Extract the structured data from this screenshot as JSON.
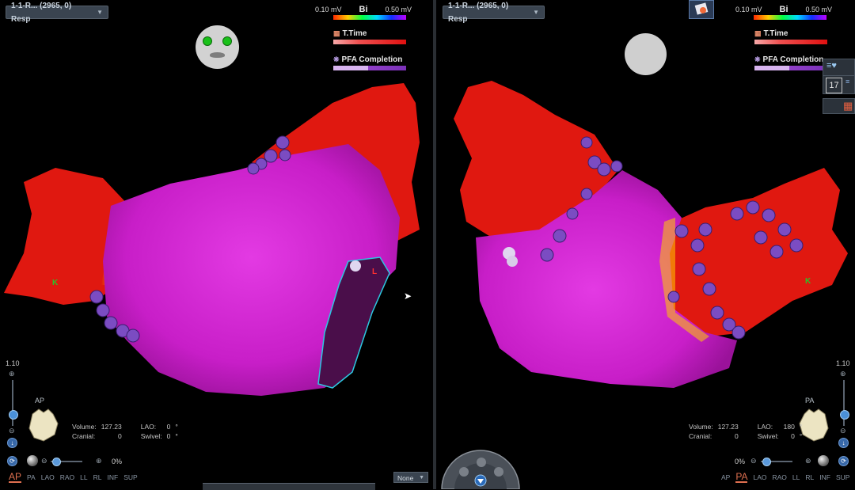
{
  "left_view": {
    "map_selector": "1-1-R... (2965, 0) Resp",
    "scale": {
      "min": "0.10 mV",
      "label": "Bi",
      "max": "0.50 mV"
    },
    "legend": {
      "ttime_label": "T.Time",
      "pfa_label": "PFA Completion",
      "pfa_completion": 0.48
    },
    "zoom": "1.10",
    "orientation_label": "AP",
    "info": {
      "volume_label": "Volume:",
      "volume_value": "127.23",
      "lao_label": "LAO:",
      "lao_value": "0",
      "cranial_label": "Cranial:",
      "cranial_value": "0",
      "swivel_label": "Swivel:",
      "swivel_value": "0",
      "deg": "°"
    },
    "slider_percent": "0%",
    "views": [
      "AP",
      "PA",
      "LAO",
      "RAO",
      "LL",
      "RL",
      "INF",
      "SUP"
    ],
    "active_view": "AP",
    "display_select": "None",
    "markers": {
      "k": "K",
      "l": "L"
    }
  },
  "right_view": {
    "map_selector": "1-1-R... (2965, 0) Resp",
    "scale": {
      "min": "0.10 mV",
      "label": "Bi",
      "max": "0.50 mV"
    },
    "legend": {
      "ttime_label": "T.Time",
      "pfa_label": "PFA Completion",
      "pfa_completion": 0.48
    },
    "zoom": "1.10",
    "orientation_label": "PA",
    "info": {
      "volume_label": "Volume:",
      "volume_value": "127.23",
      "lao_label": "LAO:",
      "lao_value": "180",
      "cranial_label": "Cranial:",
      "cranial_value": "0",
      "swivel_label": "Swivel:",
      "swivel_value": "0",
      "deg": "°"
    },
    "slider_percent": "0%",
    "views": [
      "AP",
      "PA",
      "LAO",
      "RAO",
      "LL",
      "RL",
      "INF",
      "SUP"
    ],
    "active_view": "PA",
    "markers": {
      "k": "K"
    },
    "side_tools": {
      "counter": "17"
    }
  },
  "colors": {
    "map_magenta": "#c81ec8",
    "map_red": "#e01810",
    "lesion_purple": "#7b4cc2",
    "background": "#000000",
    "panel": "#3a4450"
  }
}
